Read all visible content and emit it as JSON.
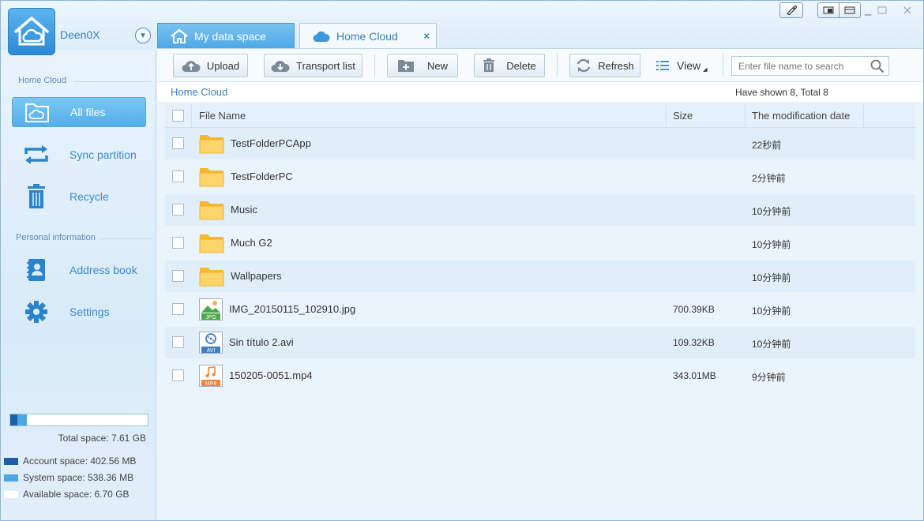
{
  "header": {
    "username": "Deen0X",
    "tabs": [
      {
        "label": "My data space",
        "icon": "home-icon"
      },
      {
        "label": "Home Cloud",
        "icon": "cloud-icon",
        "close": "×"
      }
    ]
  },
  "sidebar": {
    "home_cloud_title": "Home Cloud",
    "personal_title": "Personal information",
    "items": [
      {
        "label": "All files",
        "icon": "folder-cloud-icon"
      },
      {
        "label": "Sync partition",
        "icon": "sync-icon"
      },
      {
        "label": "Recycle",
        "icon": "trash-icon"
      },
      {
        "label": "Address book",
        "icon": "address-book-icon"
      },
      {
        "label": "Settings",
        "icon": "gear-icon"
      }
    ],
    "storage": {
      "total": "Total space: 7.61 GB",
      "account": "Account space: 402.56 MB",
      "system": "System space: 538.36 MB",
      "available": "Available space: 6.70 GB",
      "account_fraction": 0.053,
      "system_fraction": 0.071,
      "colors": {
        "account": "#1b5fa8",
        "system": "#4ea6e4",
        "available": "#ffffff"
      }
    }
  },
  "toolbar": {
    "upload": "Upload",
    "transport": "Transport list",
    "new": "New",
    "delete": "Delete",
    "refresh": "Refresh",
    "view": "View",
    "search_placeholder": "Enter file name to search"
  },
  "breadcrumb": {
    "path": "Home Cloud",
    "shown": "Have shown 8, Total 8"
  },
  "table": {
    "columns": {
      "name": "File Name",
      "size": "Size",
      "date": "The modification date"
    },
    "rows": [
      {
        "type": "folder",
        "name": "TestFolderPCApp",
        "size": "",
        "date": "22秒前"
      },
      {
        "type": "folder",
        "name": "TestFolderPC",
        "size": "",
        "date": "2分钟前"
      },
      {
        "type": "folder",
        "name": "Music",
        "size": "",
        "date": "10分钟前"
      },
      {
        "type": "folder",
        "name": "Much G2",
        "size": "",
        "date": "10分钟前"
      },
      {
        "type": "folder",
        "name": "Wallpapers",
        "size": "",
        "date": "10分钟前"
      },
      {
        "type": "jpg",
        "ext": "JPG",
        "name": "IMG_20150115_102910.jpg",
        "size": "700.39KB",
        "date": "10分钟前"
      },
      {
        "type": "avi",
        "ext": "AVI",
        "name": "Sin título 2.avi",
        "size": "109.32KB",
        "date": "10分钟前"
      },
      {
        "type": "mp4",
        "ext": "MP4",
        "name": "150205-0051.mp4",
        "size": "343.01MB",
        "date": "9分钟前"
      }
    ]
  }
}
